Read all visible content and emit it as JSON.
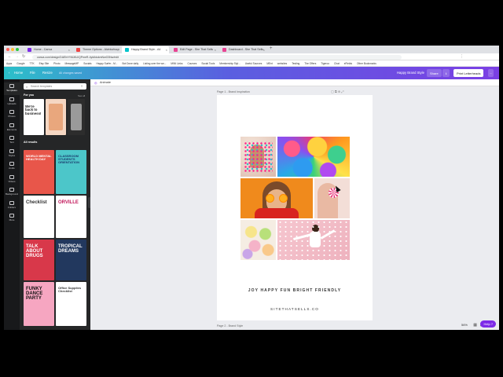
{
  "browser": {
    "tabs": [
      {
        "label": "Home - Canva",
        "color": "#7d2ae8"
      },
      {
        "label": "Theme Options - Alvinturburn",
        "color": "#e44"
      },
      {
        "label": "Happy Brand Style - A4",
        "color": "#00c4cc",
        "active": true
      },
      {
        "label": "Edit Page - She That Sells",
        "color": "#e84393"
      },
      {
        "label": "Dashboard - She That Sells",
        "color": "#e84393"
      }
    ],
    "new_tab": "+",
    "url": "canva.com/design/DAEhHYi6J6U/QPmeR-4ytdldokmNwG3Nw/edit",
    "bookmarks": [
      "Apps",
      "Google",
      "TTK",
      "Etsy Site",
      "Photo",
      "MessageMP",
      "Socials",
      "Happy Surfer - M...",
      "Bot Done daily",
      "Listing over the we...",
      "MINI Links",
      "Courses",
      "Social Tools",
      "Membership Styl...",
      "Useful Sources",
      "MEnt",
      "websites",
      "Testing",
      "The Offers",
      "Tigeroo",
      "Chat",
      "eFields",
      "Other Bookmarks"
    ]
  },
  "header": {
    "home": "Home",
    "file": "File",
    "resize": "Resize",
    "saved": "All changes saved",
    "design_title": "Happy Brand Style",
    "share": "Share",
    "print": "Print Letterheads",
    "more": "..."
  },
  "rail": [
    {
      "label": "Templates",
      "on": true
    },
    {
      "label": "Uploads"
    },
    {
      "label": "Photos"
    },
    {
      "label": "Elements"
    },
    {
      "label": "Text"
    },
    {
      "label": "Styles"
    },
    {
      "label": "Audio"
    },
    {
      "label": "Videos"
    },
    {
      "label": "Background"
    },
    {
      "label": "Folders"
    },
    {
      "label": "More"
    }
  ],
  "panel": {
    "search_placeholder": "Search templates",
    "for_you": "For you",
    "see_all": "See all",
    "all_results": "All results",
    "templates": [
      {
        "text": "We're back to business!",
        "bg": "#ffffff",
        "fg": "#222"
      },
      {
        "text": "WORLD MENTAL HEALTH DAY",
        "bg": "#e8564a",
        "fg": "#ffffff"
      },
      {
        "text": "CLASSROOM STUDENTS ORIENTATION",
        "bg": "#4cc6c9",
        "fg": "#1a3a6b"
      },
      {
        "text": "Checklist",
        "bg": "#ffffff",
        "fg": "#333"
      },
      {
        "text": "ORVILLE",
        "bg": "#ffffff",
        "fg": "#c2185b"
      },
      {
        "text": "TALK ABOUT DRUGS",
        "bg": "#d8384a",
        "fg": "#ffffff"
      },
      {
        "text": "TROPICAL DREAMS",
        "bg": "#22385e",
        "fg": "#ffffff"
      },
      {
        "text": "FUNKY DANCE PARTY",
        "bg": "#f6a6c1",
        "fg": "#101010"
      },
      {
        "text": "Office Supplies Checklist",
        "bg": "#ffffff",
        "fg": "#333"
      }
    ]
  },
  "toolbar": {
    "animate": "Animate"
  },
  "canvas": {
    "page1_label": "Page 1 - Brand Inspiration",
    "page2_label": "Page 2 - Brand Style",
    "tagline": "JOY HAPPY FUN BRIGHT FRIENDLY",
    "website": "SITETHATSELLS.CO"
  },
  "footer": {
    "zoom": "56%",
    "help": "Help ?"
  }
}
